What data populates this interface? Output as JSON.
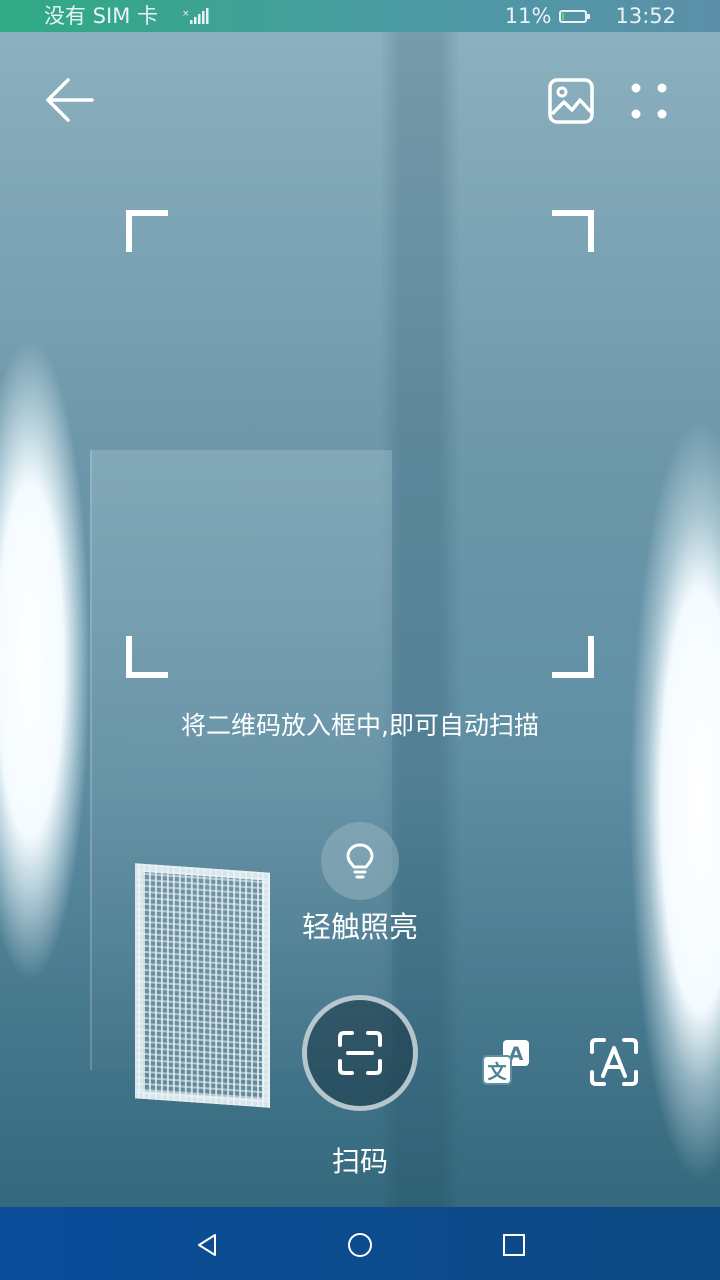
{
  "status_bar": {
    "carrier": "没有 SIM 卡",
    "battery_percent": "11%",
    "battery_level": 0.11,
    "time": "13:52"
  },
  "toolbar": {
    "back_icon": "arrow-left-icon",
    "gallery_icon": "image-icon",
    "more_icon": "more-dots-icon"
  },
  "scanner": {
    "hint": "将二维码放入框中,即可自动扫描",
    "torch_label": "轻触照亮",
    "modes": [
      {
        "label": "扫码",
        "icon": "scan-code-icon",
        "active": true
      },
      {
        "label": "",
        "icon": "translate-icon",
        "active": false
      },
      {
        "label": "",
        "icon": "text-recognition-icon",
        "active": false
      }
    ]
  },
  "nav_bar": {
    "back_icon": "nav-back-icon",
    "home_icon": "nav-home-icon",
    "recents_icon": "nav-recents-icon"
  }
}
